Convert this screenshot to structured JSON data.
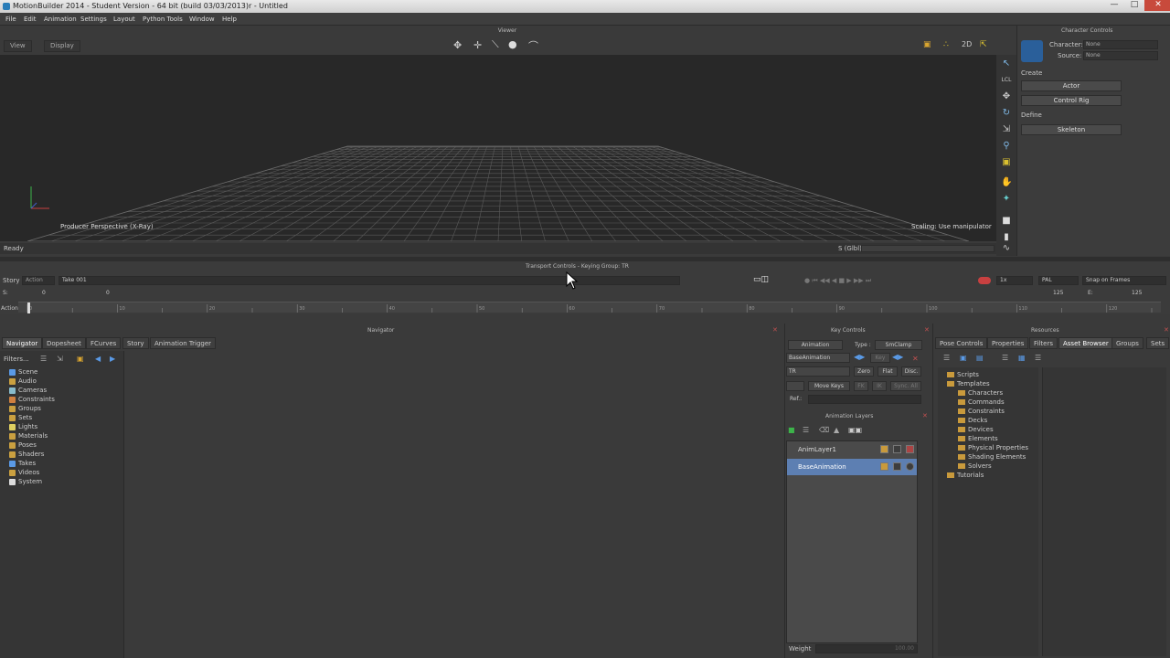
{
  "window": {
    "title": "MotionBuilder 2014 - Student Version    - 64 bit (build 03/03/2013)r  - Untitled"
  },
  "menu": [
    "File",
    "Edit",
    "Animation",
    "Settings",
    "Layout",
    "Python Tools",
    "Window",
    "Help"
  ],
  "viewer": {
    "caption": "Viewer",
    "view_btn": "View",
    "display_btn": "Display",
    "camera_label": "Producer Perspective (X-Ray)",
    "scaling_label": "Scaling: Use manipulator",
    "status": "Ready",
    "stat": "S (Glbl)"
  },
  "character_controls": {
    "title": "Character Controls",
    "character_label": "Character:",
    "character_value": "None",
    "source_label": "Source:",
    "source_value": "None",
    "create_label": "Create",
    "actor_btn": "Actor",
    "control_rig_btn": "Control Rig",
    "define_label": "Define",
    "skeleton_btn": "Skeleton"
  },
  "transport": {
    "title": "Transport Controls - Keying Group: TR",
    "story": "Story",
    "action": "Action",
    "take": "Take 001",
    "start": "0",
    "current": "0",
    "speed": "1x",
    "fps": "PAL",
    "snap": "Snap on Frames",
    "end_frame": "125",
    "end_e": "125",
    "s_label": "S:",
    "e_label": "E:",
    "action_label": "Action",
    "ticks": [
      "0",
      "10",
      "20",
      "30",
      "40",
      "50",
      "60",
      "70",
      "80",
      "90",
      "100",
      "110",
      "120"
    ]
  },
  "navigator": {
    "title": "Navigator",
    "tabs": [
      "Navigator",
      "Dopesheet",
      "FCurves",
      "Story",
      "Animation Trigger"
    ],
    "filters": "Filters...",
    "tree": [
      "Scene",
      "Audio",
      "Cameras",
      "Constraints",
      "Groups",
      "Sets",
      "Lights",
      "Materials",
      "Poses",
      "Shaders",
      "Takes",
      "Videos",
      "System"
    ]
  },
  "key_controls": {
    "title": "Key Controls",
    "animation": "Animation",
    "type_label": "Type :",
    "type_value": "SmClamp",
    "base_layer": "BaseAnimation",
    "key": "Key",
    "tr": "TR",
    "zero": "Zero",
    "flat": "Flat",
    "disc": "Disc.",
    "move_keys": "Move Keys",
    "fk": "FK",
    "ik": "IK",
    "sync": "Sync. All",
    "ref": "Ref.:",
    "layers_title": "Animation Layers",
    "layers": [
      "AnimLayer1",
      "BaseAnimation"
    ],
    "weight": "Weight",
    "weight_value": "100.00"
  },
  "resources": {
    "title": "Resources",
    "tabs": [
      "Pose Controls",
      "Properties",
      "Filters",
      "Asset Browser",
      "Groups",
      "Sets"
    ],
    "tree": {
      "scripts": "Scripts",
      "templates": "Templates",
      "children": [
        "Characters",
        "Commands",
        "Constraints",
        "Decks",
        "Devices",
        "Elements",
        "Physical Properties",
        "Shading Elements",
        "Solvers"
      ],
      "tutorials": "Tutorials"
    }
  },
  "colors": {
    "accent": "#5d7fb2",
    "close": "#c84a3c"
  }
}
